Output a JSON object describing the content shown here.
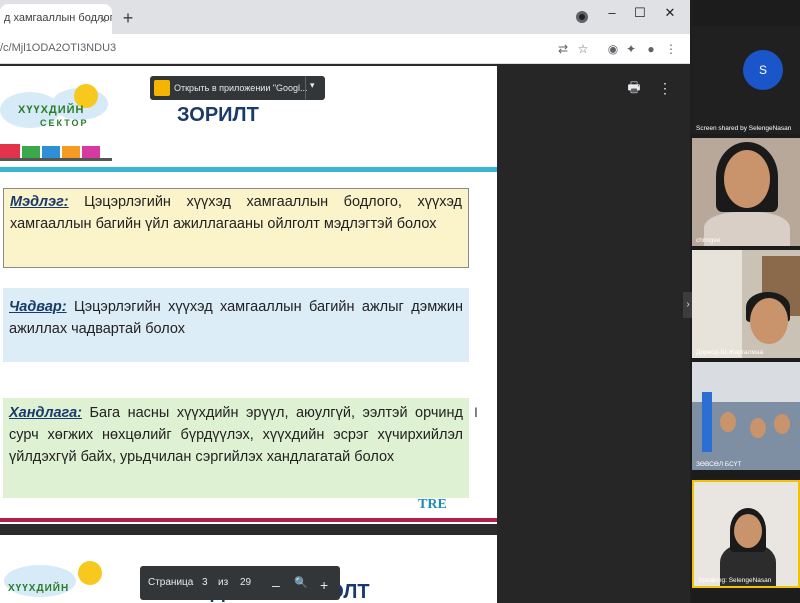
{
  "browser": {
    "tab_title": "д хамгааллын бодлогын с",
    "tab_close": "×",
    "new_tab": "+",
    "window_controls": [
      "–",
      "☐",
      "✕"
    ],
    "url": "/c/Mjl1ODA2OTI3NDU3",
    "toolbar_icons": [
      "translate-icon",
      "star-icon",
      "extension-icon",
      "puzzle-icon",
      "profile-icon",
      "menu-icon"
    ]
  },
  "pdf_viewer": {
    "open_in_app_label": "Открыть в приложении \"Googl...",
    "open_in_app_arrow": "▾",
    "print_icon": "🖶",
    "more_icon": "⋮",
    "pager": {
      "label": "Страница",
      "current": "3",
      "of": "из",
      "total": "29",
      "zoom_out": "–",
      "zoom_icon": "🔍",
      "zoom_in": "+"
    },
    "side_handle": "›"
  },
  "slide": {
    "logo_line1": "ХҮҮХДИЙН",
    "logo_line2": "СЕКТОР",
    "title": "ЗОРИЛТ",
    "boxes": [
      {
        "term": "Мэдлэг:",
        "text": " Цэцэрлэгийн хүүхэд хамгааллын бодлого, хүүхэд хамгааллын багийн үйл ажиллагааны ойлголт мэдлэгтэй болох"
      },
      {
        "term": "Чадвар:",
        "text": " Цэцэрлэгийн хүүхэд хамгааллын багийн ажлыг дэмжин ажиллах чадвартай болох"
      },
      {
        "term": "Хандлага:",
        "text": " Бага насны хүүхдийн эрүүл, аюулгүй, ээлтэй орчинд сурч хөгжих нөхцөлийг бүрдүүлэх, хүүхдийн эсрэг хүчирхийлэл үйлдэхгүй байх, урьдчилан сэргийлэх хандлагатай болох"
      }
    ],
    "cursor": "I",
    "corner_label": "TRE"
  },
  "next_slide": {
    "logo_line1": "ХҮҮХДИЙН",
    "title": "ҮНДСЭН ОЙЛГОЛТ"
  },
  "meeting": {
    "presenter_initial": "S",
    "participants": [
      {
        "label": "Screen shared by SelengeNasan"
      },
      {
        "label": "chimgee"
      },
      {
        "label": "Дорнод-Ш.Жаргалмаа"
      },
      {
        "label": "ЗӨВСӨЛ БСҮТ"
      },
      {
        "label": "Speaking: SelengeNasan"
      }
    ]
  }
}
